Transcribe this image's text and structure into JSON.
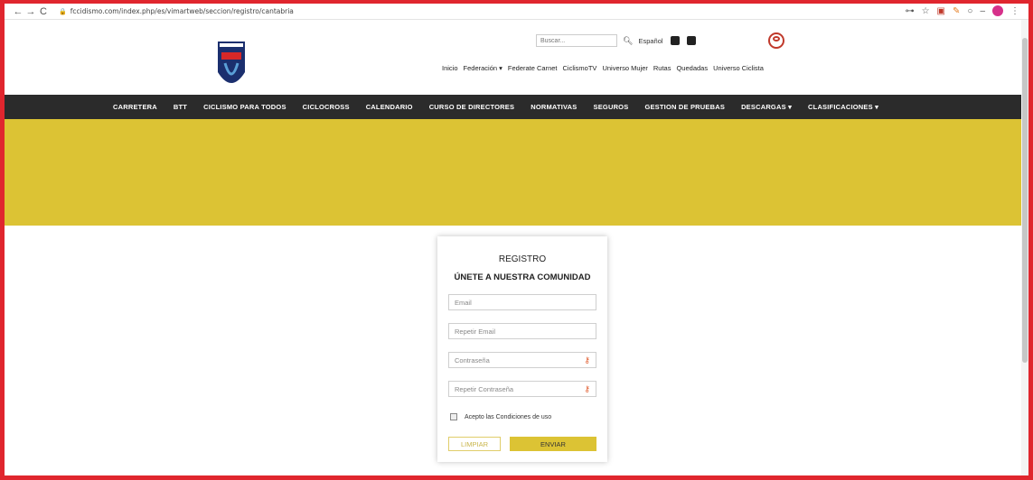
{
  "browser": {
    "back": "←",
    "forward": "→",
    "reload": "C",
    "url": "fccidismo.com/index.php/es/vimartweb/seccion/registro/cantabria"
  },
  "search": {
    "placeholder": "Buscar..."
  },
  "header": {
    "language": "Español",
    "top_links": [
      "Inicio",
      "Federación ▾",
      "Federate Carnet",
      "CiclismoTV",
      "Universo Mujer",
      "Rutas",
      "Quedadas",
      "Universo Ciclista"
    ]
  },
  "nav": {
    "items": [
      "CARRETERA",
      "BTT",
      "CICLISMO PARA TODOS",
      "CICLOCROSS",
      "CALENDARIO",
      "CURSO DE DIRECTORES",
      "NORMATIVAS",
      "SEGUROS",
      "GESTION DE PRUEBAS",
      "DESCARGAS ▾",
      "CLASIFICACIONES ▾"
    ]
  },
  "colors": {
    "accent": "#dcc334",
    "nav_bg": "#2b2b2b",
    "frame": "#e0262e"
  },
  "form": {
    "title": "REGISTRO",
    "subtitle": "ÚNETE A NUESTRA COMUNIDAD",
    "email_placeholder": "Email",
    "repeat_email_placeholder": "Repetir Email",
    "password_placeholder": "Contraseña",
    "repeat_password_placeholder": "Repetir Contraseña",
    "terms_label": "Acepto las Condiciones de uso",
    "clear_button": "LIMPIAR",
    "submit_button": "ENVIAR"
  }
}
